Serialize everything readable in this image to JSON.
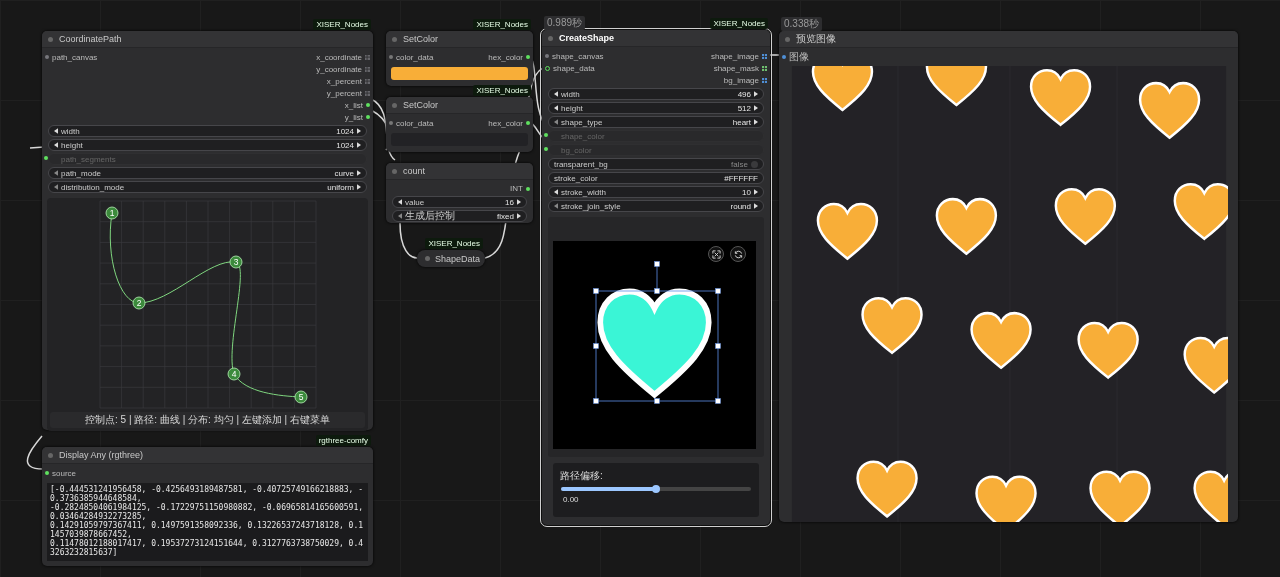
{
  "coordinate_path": {
    "badge": "XISER_Nodes",
    "title": "CoordinatePath",
    "inputs": [
      {
        "label": "path_canvas",
        "kind": "open"
      }
    ],
    "outputs": [
      {
        "label": "x_coordinate",
        "kind": "list"
      },
      {
        "label": "y_coordinate",
        "kind": "list"
      },
      {
        "label": "x_percent",
        "kind": "list"
      },
      {
        "label": "y_percent",
        "kind": "list"
      },
      {
        "label": "x_list",
        "kind": "linked"
      },
      {
        "label": "y_list",
        "kind": "linked"
      }
    ],
    "widgets": [
      {
        "kind": "number",
        "label": "width",
        "value": "1024"
      },
      {
        "kind": "number",
        "label": "height",
        "value": "1024"
      },
      {
        "kind": "slot",
        "label": "path_segments"
      },
      {
        "kind": "combo",
        "label": "path_mode",
        "value": "curve"
      },
      {
        "kind": "combo",
        "label": "distribution_mode",
        "value": "uniform"
      }
    ],
    "editor": {
      "points": [
        {
          "label": "1"
        },
        {
          "label": "2"
        },
        {
          "label": "3"
        },
        {
          "label": "4"
        },
        {
          "label": "5"
        }
      ],
      "status": "控制点: 5 | 路径: 曲线 | 分布: 均匀 | 左键添加 | 右键菜单"
    }
  },
  "display_any": {
    "badge": "rgthree-comfy",
    "title": "Display Any (rgthree)",
    "inputs": [
      {
        "label": "source",
        "kind": "linked"
      }
    ],
    "text": "[-0.444531241956458, -0.4256493189487581, -0.40725749166218883, -0.3736385944648584,\n-0.28248504061984125, -0.17229751150980882, -0.06965814165600591, 0.03464284932273285,\n0.14291059797367411, 0.1497591358092336, 0.13226537243718128, 0.11457039878667452,\n0.11478012188017417, 0.19537273124151644, 0.3127763738750029, 0.43263232815637]"
  },
  "set_color": [
    {
      "badge": "XISER_Nodes",
      "title": "SetColor",
      "input": "color_data",
      "output": "hex_color",
      "color": "#f8ae38"
    },
    {
      "badge": "XISER_Nodes",
      "title": "SetColor",
      "input": "color_data",
      "output": "hex_color",
      "color": "#222225"
    }
  ],
  "count": {
    "title": "count",
    "output": "INT",
    "widgets": [
      {
        "kind": "number",
        "label": "value",
        "value": "16"
      },
      {
        "kind": "combo",
        "label": "生成后控制",
        "value": "fixed"
      }
    ]
  },
  "shape_data": {
    "badge": "XISER_Nodes",
    "title": "ShapeData"
  },
  "create_shape": {
    "time": "0.989秒",
    "badge": "XISER_Nodes",
    "title": "CreateShape",
    "inputs": [
      {
        "label": "shape_canvas",
        "kind": "open"
      },
      {
        "label": "shape_data",
        "kind": "ring"
      }
    ],
    "outputs": [
      {
        "label": "shape_image",
        "kind": "image"
      },
      {
        "label": "shape_mask",
        "kind": "mask"
      },
      {
        "label": "bg_image",
        "kind": "image"
      }
    ],
    "widgets": [
      {
        "kind": "number",
        "label": "width",
        "value": "496"
      },
      {
        "kind": "number",
        "label": "height",
        "value": "512"
      },
      {
        "kind": "combo",
        "label": "shape_type",
        "value": "heart"
      },
      {
        "kind": "slot",
        "label": "shape_color"
      },
      {
        "kind": "slot",
        "label": "bg_color"
      },
      {
        "kind": "toggle",
        "label": "transparent_bg",
        "value": "false"
      },
      {
        "kind": "text",
        "label": "stroke_color",
        "value": "#FFFFFF"
      },
      {
        "kind": "number",
        "label": "stroke_width",
        "value": "10"
      },
      {
        "kind": "combo",
        "label": "stroke_join_style",
        "value": "round"
      }
    ],
    "slider": {
      "label": "路径偏移:",
      "level": 0.5,
      "reading": "0.00"
    }
  },
  "preview": {
    "time": "0.338秒",
    "title": "预览图像",
    "inputs": [
      {
        "label": "图像",
        "kind": "image"
      }
    ]
  }
}
